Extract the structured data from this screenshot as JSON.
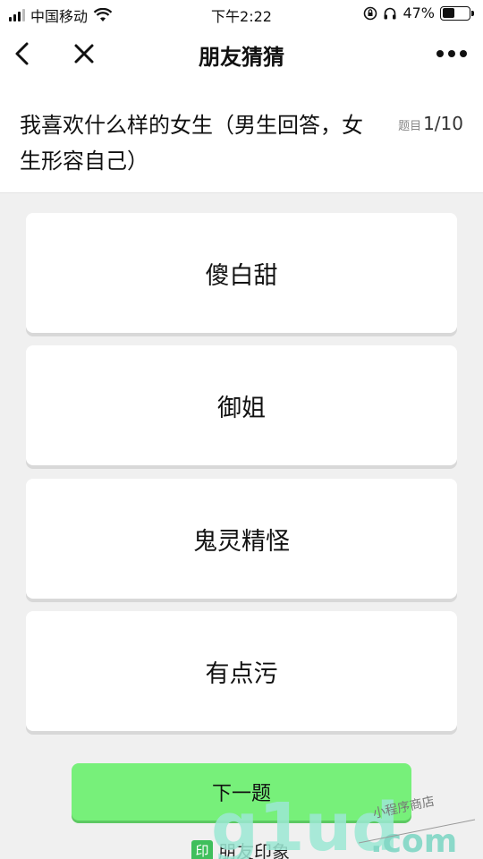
{
  "status_bar": {
    "carrier": "中国移动",
    "time": "下午2:22",
    "battery_percent": "47%",
    "battery_level": 47
  },
  "nav": {
    "title": "朋友猜猜"
  },
  "question": {
    "text": "我喜欢什么样的女生（男生回答，女生形容自己）",
    "progress_label": "题目",
    "progress_value": "1/10"
  },
  "options": [
    {
      "label": "傻白甜"
    },
    {
      "label": "御姐"
    },
    {
      "label": "鬼灵精怪"
    },
    {
      "label": "有点污"
    }
  ],
  "next_button": {
    "label": "下一题"
  },
  "footer": {
    "badge": "印",
    "brand": "朋友印象"
  },
  "watermark": {
    "main": "g1ud",
    "suffix": ".com",
    "tagline": "小程序商店"
  },
  "colors": {
    "accent_green": "#77f07a",
    "badge_green": "#3fbf5c",
    "background": "#f0f0f0"
  }
}
